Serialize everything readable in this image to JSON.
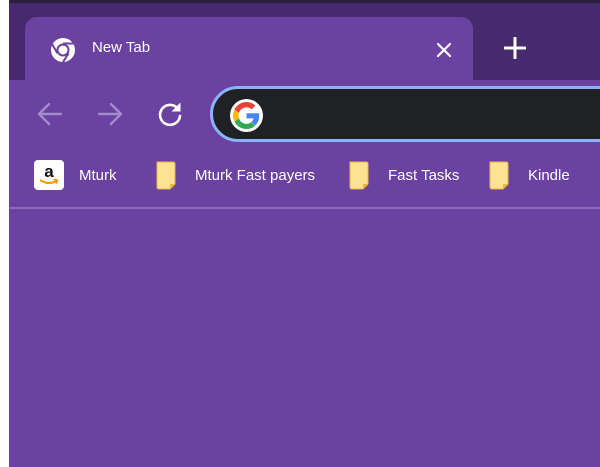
{
  "tab": {
    "title": "New Tab",
    "icon": "chrome-icon"
  },
  "toolbar": {
    "back_icon": "back-arrow-icon",
    "forward_icon": "forward-arrow-icon",
    "reload_icon": "reload-icon"
  },
  "omnibox": {
    "value": "",
    "icon": "google-icon"
  },
  "bookmarks": [
    {
      "label": "Mturk",
      "icon": "amazon-icon"
    },
    {
      "label": "Mturk Fast payers",
      "icon": "folder-icon"
    },
    {
      "label": "Fast Tasks",
      "icon": "folder-icon"
    },
    {
      "label": "Kindle",
      "icon": "folder-icon"
    }
  ],
  "colors": {
    "frame": "#47296e",
    "toolbar": "#6b42a1",
    "omnibox_border": "#8ab4f8",
    "omnibox_bg": "#202124"
  }
}
